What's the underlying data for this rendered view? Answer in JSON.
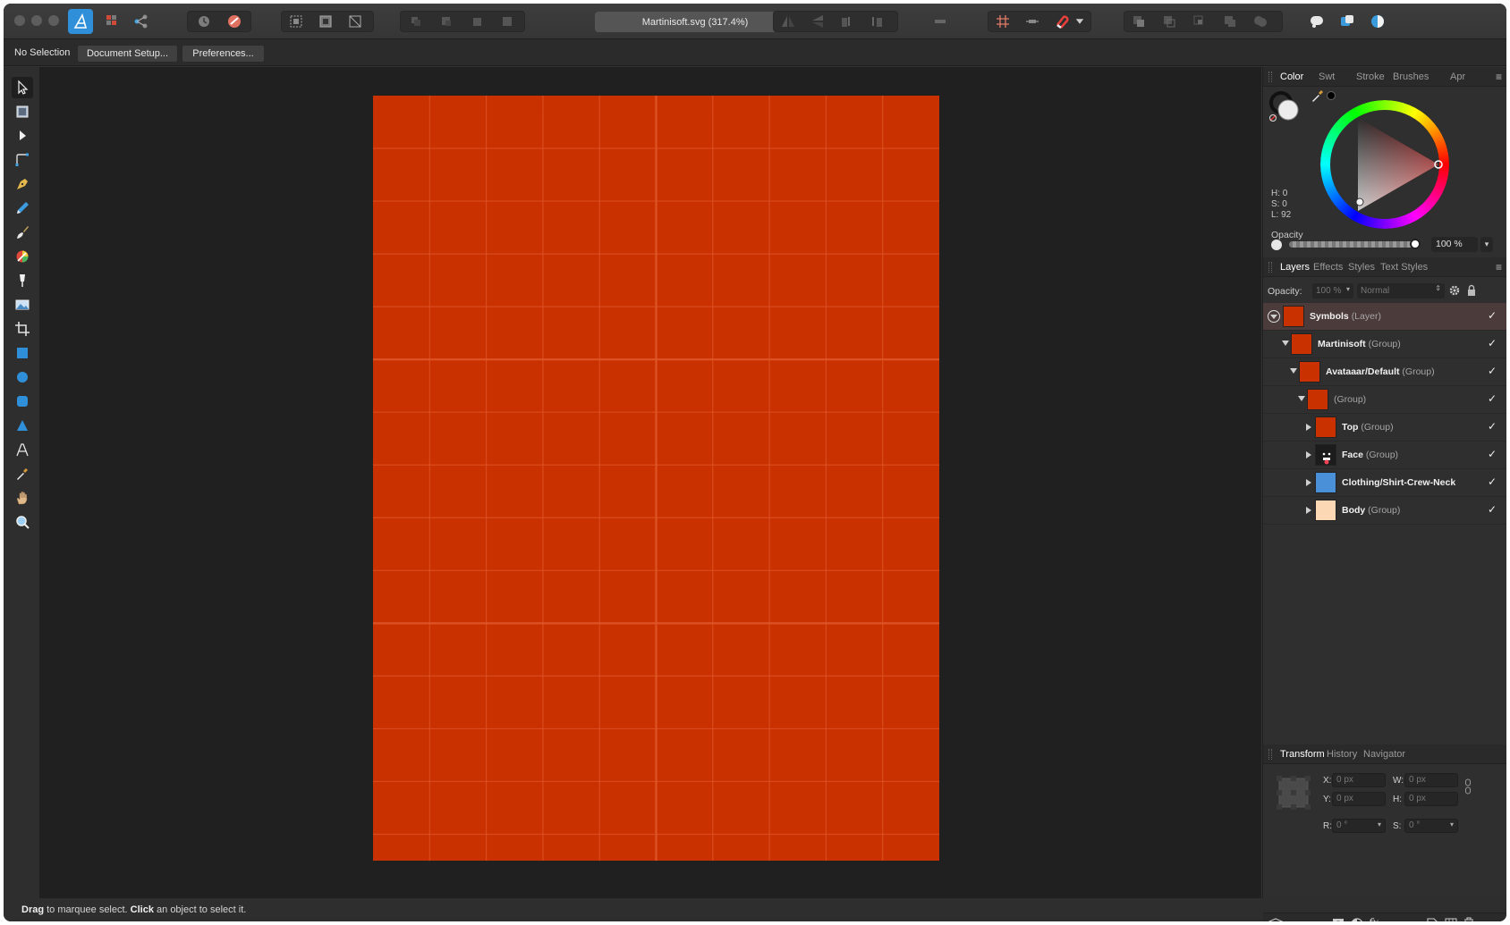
{
  "window": {
    "title": "Martinisoft.svg (317.4%)"
  },
  "context_bar": {
    "selection_status": "No Selection",
    "document_setup_label": "Document Setup...",
    "preferences_label": "Preferences..."
  },
  "color_panel": {
    "tabs": [
      "Color",
      "Swt",
      "Stroke",
      "Brushes",
      "Apr"
    ],
    "active_tab": "Color",
    "h": "H: 0",
    "s": "S: 0",
    "l": "L: 92",
    "opacity_label": "Opacity",
    "opacity_value": "100 %",
    "opacity_level": 1.0
  },
  "layers_panel": {
    "tabs": [
      "Layers",
      "Effects",
      "Styles",
      "Text Styles"
    ],
    "active_tab": "Layers",
    "opacity_label": "Opacity:",
    "opacity_value": "100 %",
    "blend_mode": "Normal",
    "layers": [
      {
        "name": "Symbols",
        "type": "(Layer)",
        "depth": 0,
        "expanded": true,
        "visible": true,
        "selected": true,
        "thumb": "#c93200"
      },
      {
        "name": "Martinisoft",
        "type": "(Group)",
        "depth": 1,
        "expanded": true,
        "visible": true,
        "selected": false,
        "thumb": "#c93200"
      },
      {
        "name": "Avataaar/Default",
        "type": "(Group)",
        "depth": 2,
        "expanded": true,
        "visible": true,
        "selected": false,
        "thumb": "#c93200"
      },
      {
        "name": "",
        "type": "(Group)",
        "depth": 3,
        "expanded": true,
        "visible": true,
        "selected": false,
        "thumb": "#c93200"
      },
      {
        "name": "Top",
        "type": "(Group)",
        "depth": 4,
        "expanded": false,
        "visible": true,
        "selected": false,
        "thumb": "#c93200"
      },
      {
        "name": "Face",
        "type": "(Group)",
        "depth": 4,
        "expanded": false,
        "visible": true,
        "selected": false,
        "thumb": "face"
      },
      {
        "name": "Clothing/Shirt-Crew-Neck",
        "type": "",
        "depth": 4,
        "expanded": false,
        "visible": true,
        "selected": false,
        "thumb": "#4a90d9"
      },
      {
        "name": "Body",
        "type": "(Group)",
        "depth": 4,
        "expanded": false,
        "visible": true,
        "selected": false,
        "thumb": "#fdd8b5"
      }
    ]
  },
  "transform_panel": {
    "tabs": [
      "Transform",
      "History",
      "Navigator"
    ],
    "active_tab": "Transform",
    "x_label": "X:",
    "x_value": "0 px",
    "y_label": "Y:",
    "y_value": "0 px",
    "w_label": "W:",
    "w_value": "0 px",
    "h_label": "H:",
    "h_value": "0 px",
    "r_label": "R:",
    "r_value": "0 °",
    "s_label": "S:",
    "s_value": "0 °"
  },
  "status_bar": {
    "drag_word": "Drag",
    "drag_text": " to marquee select. ",
    "click_word": "Click",
    "click_text": " an object to select it."
  },
  "colors": {
    "artboard": "#c93200",
    "grid_line": "#e0562b",
    "accent": "#ff6a4a",
    "selected_row": "#4c3b3b"
  },
  "tools": [
    "move-tool",
    "artboard-tool",
    "node-tool",
    "corner-tool",
    "pen-tool",
    "pencil-tool",
    "vector-brush-tool",
    "fill-tool",
    "transparency-tool",
    "place-image-tool",
    "crop-tool",
    "rectangle-tool",
    "ellipse-tool",
    "rounded-rectangle-tool",
    "triangle-tool",
    "text-tool",
    "color-picker-tool",
    "hand-tool",
    "zoom-tool"
  ]
}
